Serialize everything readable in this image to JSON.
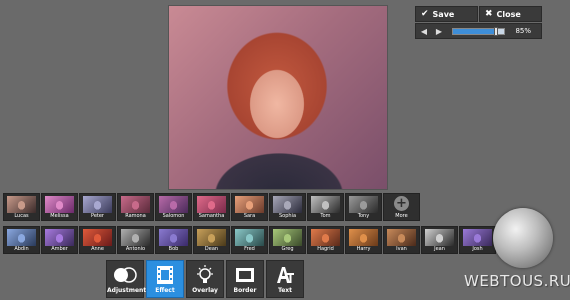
{
  "panel": {
    "save_label": "Save",
    "close_label": "Close",
    "zoom_value": "85%",
    "zoom_fraction": 0.85
  },
  "effects_row1": [
    {
      "label": "Lucas",
      "c1": "#3a2a2a",
      "c2": "#c89a8a"
    },
    {
      "label": "Melissa",
      "c1": "#6a2a6a",
      "c2": "#e08ac8"
    },
    {
      "label": "Peter",
      "c1": "#3a3a5a",
      "c2": "#a8a8d0"
    },
    {
      "label": "Ramona",
      "c1": "#5a2a3a",
      "c2": "#c86a8a"
    },
    {
      "label": "Salomon",
      "c1": "#4a2a5a",
      "c2": "#b86aa8"
    },
    {
      "label": "Samantha",
      "c1": "#7a2a4a",
      "c2": "#e06a8a"
    },
    {
      "label": "Sara",
      "c1": "#6a3a2a",
      "c2": "#e8a07a"
    },
    {
      "label": "Sophia",
      "c1": "#2a2a3a",
      "c2": "#a8a8b8"
    },
    {
      "label": "Tom",
      "c1": "#2a2a2a",
      "c2": "#c0c0c0"
    },
    {
      "label": "Tony",
      "c1": "#2a2a2a",
      "c2": "#9a9a9a"
    }
  ],
  "more_label": "More",
  "effects_row2": [
    {
      "label": "Abdin",
      "c1": "#2a3a5a",
      "c2": "#8aa8e0"
    },
    {
      "label": "Amber",
      "c1": "#3a2a5a",
      "c2": "#a87ae0"
    },
    {
      "label": "Anne",
      "c1": "#6a1a1a",
      "c2": "#e05a3a"
    },
    {
      "label": "Antonio",
      "c1": "#2a2a2a",
      "c2": "#b0b0b0"
    },
    {
      "label": "Bob",
      "c1": "#3a2a6a",
      "c2": "#8a7ad0"
    },
    {
      "label": "Dean",
      "c1": "#4a3a1a",
      "c2": "#c8a05a"
    },
    {
      "label": "Fred",
      "c1": "#2a4a4a",
      "c2": "#8ac8c8"
    },
    {
      "label": "Greg",
      "c1": "#3a4a2a",
      "c2": "#a8c87a"
    },
    {
      "label": "Hagrid",
      "c1": "#5a2a1a",
      "c2": "#e07a4a"
    },
    {
      "label": "Harry",
      "c1": "#6a3a1a",
      "c2": "#e0904a"
    },
    {
      "label": "Ivan",
      "c1": "#4a2a1a",
      "c2": "#c88a5a"
    },
    {
      "label": "Jean",
      "c1": "#2a2a2a",
      "c2": "#d0d0d0"
    },
    {
      "label": "Josh",
      "c1": "#3a2a5a",
      "c2": "#9a7ad8"
    }
  ],
  "tools": [
    {
      "label": "Adjustment",
      "icon": "circles-icon",
      "active": false
    },
    {
      "label": "Effect",
      "icon": "film-icon",
      "active": true
    },
    {
      "label": "Overlay",
      "icon": "bulb-icon",
      "active": false
    },
    {
      "label": "Border",
      "icon": "frame-icon",
      "active": false
    },
    {
      "label": "Text",
      "icon": "text-icon",
      "active": false
    }
  ],
  "watermark": "WEBTOUS.RU",
  "colors": {
    "accent": "#2b8fe0",
    "background": "#6a6a6a",
    "panel": "#3a3a3a"
  }
}
